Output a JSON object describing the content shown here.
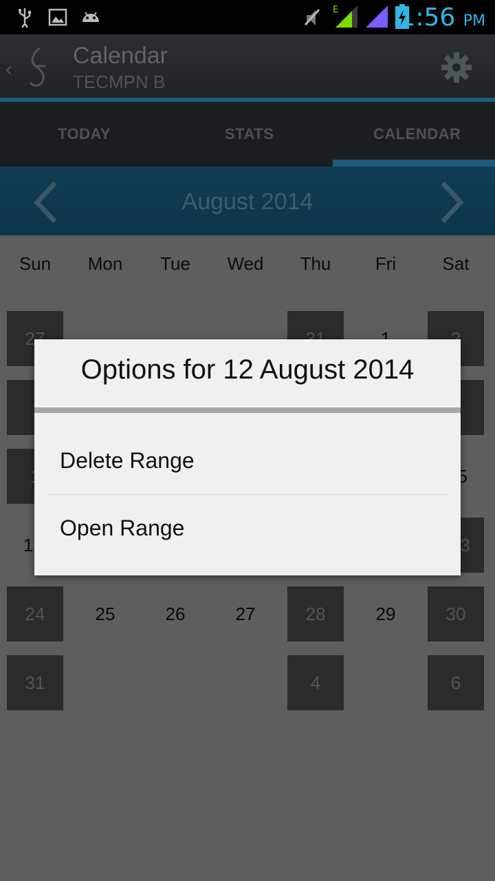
{
  "status_bar": {
    "icons": [
      "usb-icon",
      "image-icon",
      "android-icon",
      "mute-icon",
      "signal-e-icon",
      "signal-icon",
      "battery-charging-icon"
    ],
    "time": "1:56",
    "ampm": "PM"
  },
  "action_bar": {
    "title": "Calendar",
    "subtitle": "TECMPN B",
    "settings_icon": "gear-icon"
  },
  "tabs": [
    {
      "label": "TODAY"
    },
    {
      "label": "STATS"
    },
    {
      "label": "CALENDAR"
    }
  ],
  "calendar": {
    "month_title": "August 2014",
    "weekdays": [
      "Sun",
      "Mon",
      "Tue",
      "Wed",
      "Thu",
      "Fri",
      "Sat"
    ],
    "visible_days": [
      "27",
      "31",
      "1",
      "2",
      "1",
      "5",
      "1",
      "3",
      "24",
      "25",
      "26",
      "27",
      "28",
      "29",
      "30",
      "31",
      "4",
      "6"
    ]
  },
  "dialog": {
    "title": "Options for 12 August 2014",
    "items": [
      {
        "label": "Delete Range"
      },
      {
        "label": "Open Range"
      }
    ]
  },
  "colors": {
    "accent": "#33b5e5",
    "month_bar": "#103d53",
    "tab_indicator": "#1e5a78"
  }
}
